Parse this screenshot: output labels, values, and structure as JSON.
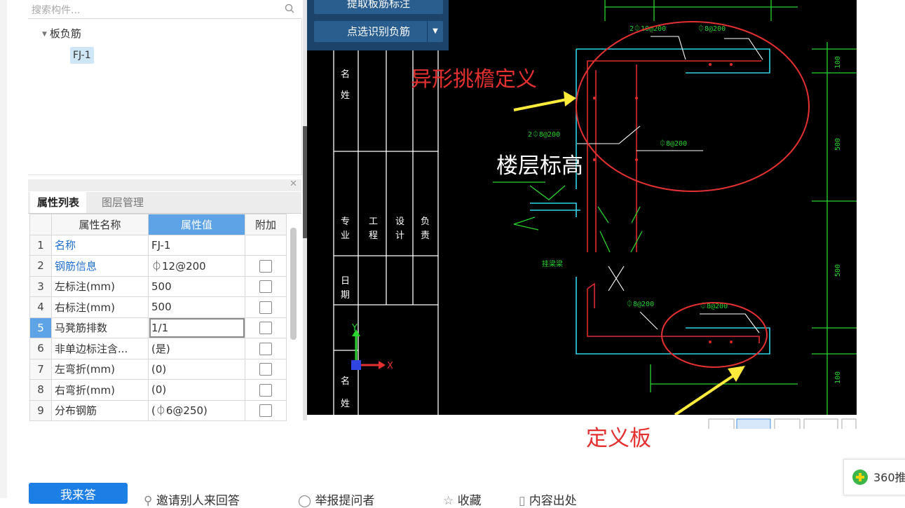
{
  "search": {
    "placeholder": "搜索构件..."
  },
  "tree": {
    "parent": "板负筋",
    "child": "FJ-1"
  },
  "tabs": {
    "active": "属性列表",
    "other": "图层管理"
  },
  "table": {
    "headers": [
      "属性名称",
      "属性值",
      "附加"
    ],
    "rows": [
      {
        "num": "1",
        "name": "名称",
        "value": "FJ-1"
      },
      {
        "num": "2",
        "name": "钢筋信息",
        "value": "⏀12@200"
      },
      {
        "num": "3",
        "name": "左标注(mm)",
        "value": "500"
      },
      {
        "num": "4",
        "name": "右标注(mm)",
        "value": "500"
      },
      {
        "num": "5",
        "name": "马凳筋排数",
        "value": "1/1"
      },
      {
        "num": "6",
        "name": "非单边标注含...",
        "value": "(是)"
      },
      {
        "num": "7",
        "name": "左弯折(mm)",
        "value": "(0)"
      },
      {
        "num": "8",
        "name": "右弯折(mm)",
        "value": "(0)"
      },
      {
        "num": "9",
        "name": "分布钢筋",
        "value": "(⏀6@250)"
      }
    ]
  },
  "cad": {
    "btn_extract": "提取板筋标注",
    "btn_pick": "点选识别负筋",
    "annot_top": "异形挑檐定义",
    "annot_floor": "楼层标高",
    "annot_bottom": "定义板",
    "dim_100_top": "100",
    "dim_500_a": "500",
    "dim_500_b": "500",
    "dim_100_bot": "100",
    "rebar_1": "2⏀10@200",
    "rebar_2": "⏀8@200",
    "rebar_3": "2⏀8@200",
    "rebar_4": "⏀8@200",
    "rebar_5": "⏀8@200",
    "rebar_6": "⏀8@200",
    "beam_label": "挂梁梁",
    "axis_y": "Y",
    "axis_x": "X"
  },
  "footer": {
    "write_answer": "我来答",
    "invite": "邀请别人来回答",
    "report": "举报提问者",
    "favorite": "收藏",
    "source": "内容出处"
  },
  "badge": {
    "label": "360推"
  }
}
